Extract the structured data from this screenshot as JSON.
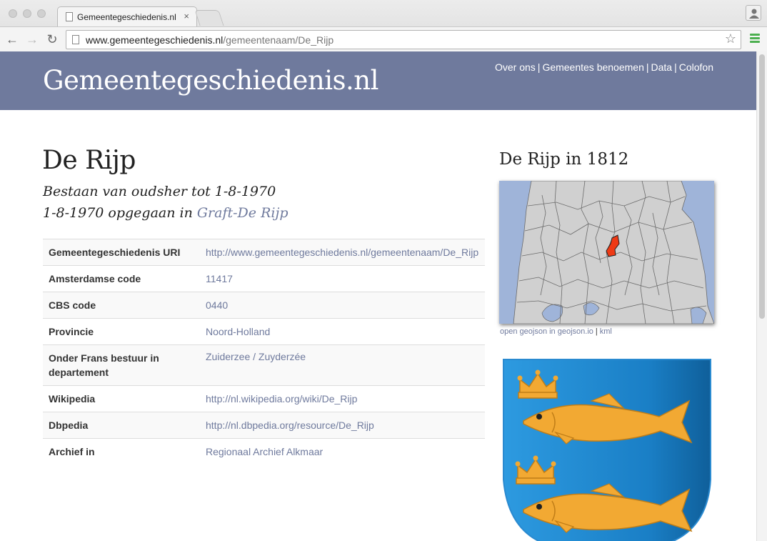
{
  "browser": {
    "tab_title": "Gemeentegeschiedenis.nl",
    "tab_close": "×",
    "url_host": "www.gemeentegeschiedenis.nl",
    "url_path": "/gemeentenaam/De_Rijp"
  },
  "site": {
    "title": "Gemeentegeschiedenis.nl",
    "nav": [
      "Over ons",
      "Gemeentes benoemen",
      "Data",
      "Colofon"
    ],
    "nav_separator": "|",
    "header_color": "#6f7a9d",
    "link_color": "#6f7a9d"
  },
  "page": {
    "heading": "De Rijp",
    "existence": "Bestaan van oudsher tot 1-8-1970",
    "merged_prefix": "1-8-1970 opgegaan in",
    "merged_into": "Graft-De Rijp"
  },
  "info_table": [
    {
      "label": "Gemeentegeschiedenis URI",
      "value": "http://www.gemeentegeschiedenis.nl/gemeentenaam/De_Rijp"
    },
    {
      "label": "Amsterdamse code",
      "value": "11417"
    },
    {
      "label": "CBS code",
      "value": "0440"
    },
    {
      "label": "Provincie",
      "value": "Noord-Holland"
    },
    {
      "label": "Onder Frans bestuur in departement",
      "value": "Zuiderzee / Zuyderzée"
    },
    {
      "label": "Wikipedia",
      "value": "http://nl.wikipedia.org/wiki/De_Rijp"
    },
    {
      "label": "Dbpedia",
      "value": "http://nl.dbpedia.org/resource/De_Rijp"
    },
    {
      "label": "Archief in",
      "value": "Regionaal Archief Alkmaar"
    }
  ],
  "map": {
    "title": "De Rijp in 1812",
    "geojson_link": "open geojson in geojson.io",
    "kml_link": "kml",
    "link_separator": "|",
    "water_color": "#9fb4d9",
    "land_color": "#d0d0d0",
    "highlight_color": "#ee3a15"
  },
  "crest": {
    "field_color": "#1a7fc6",
    "charge_color": "#f2a933",
    "icon": "coat-of-arms-icon"
  }
}
